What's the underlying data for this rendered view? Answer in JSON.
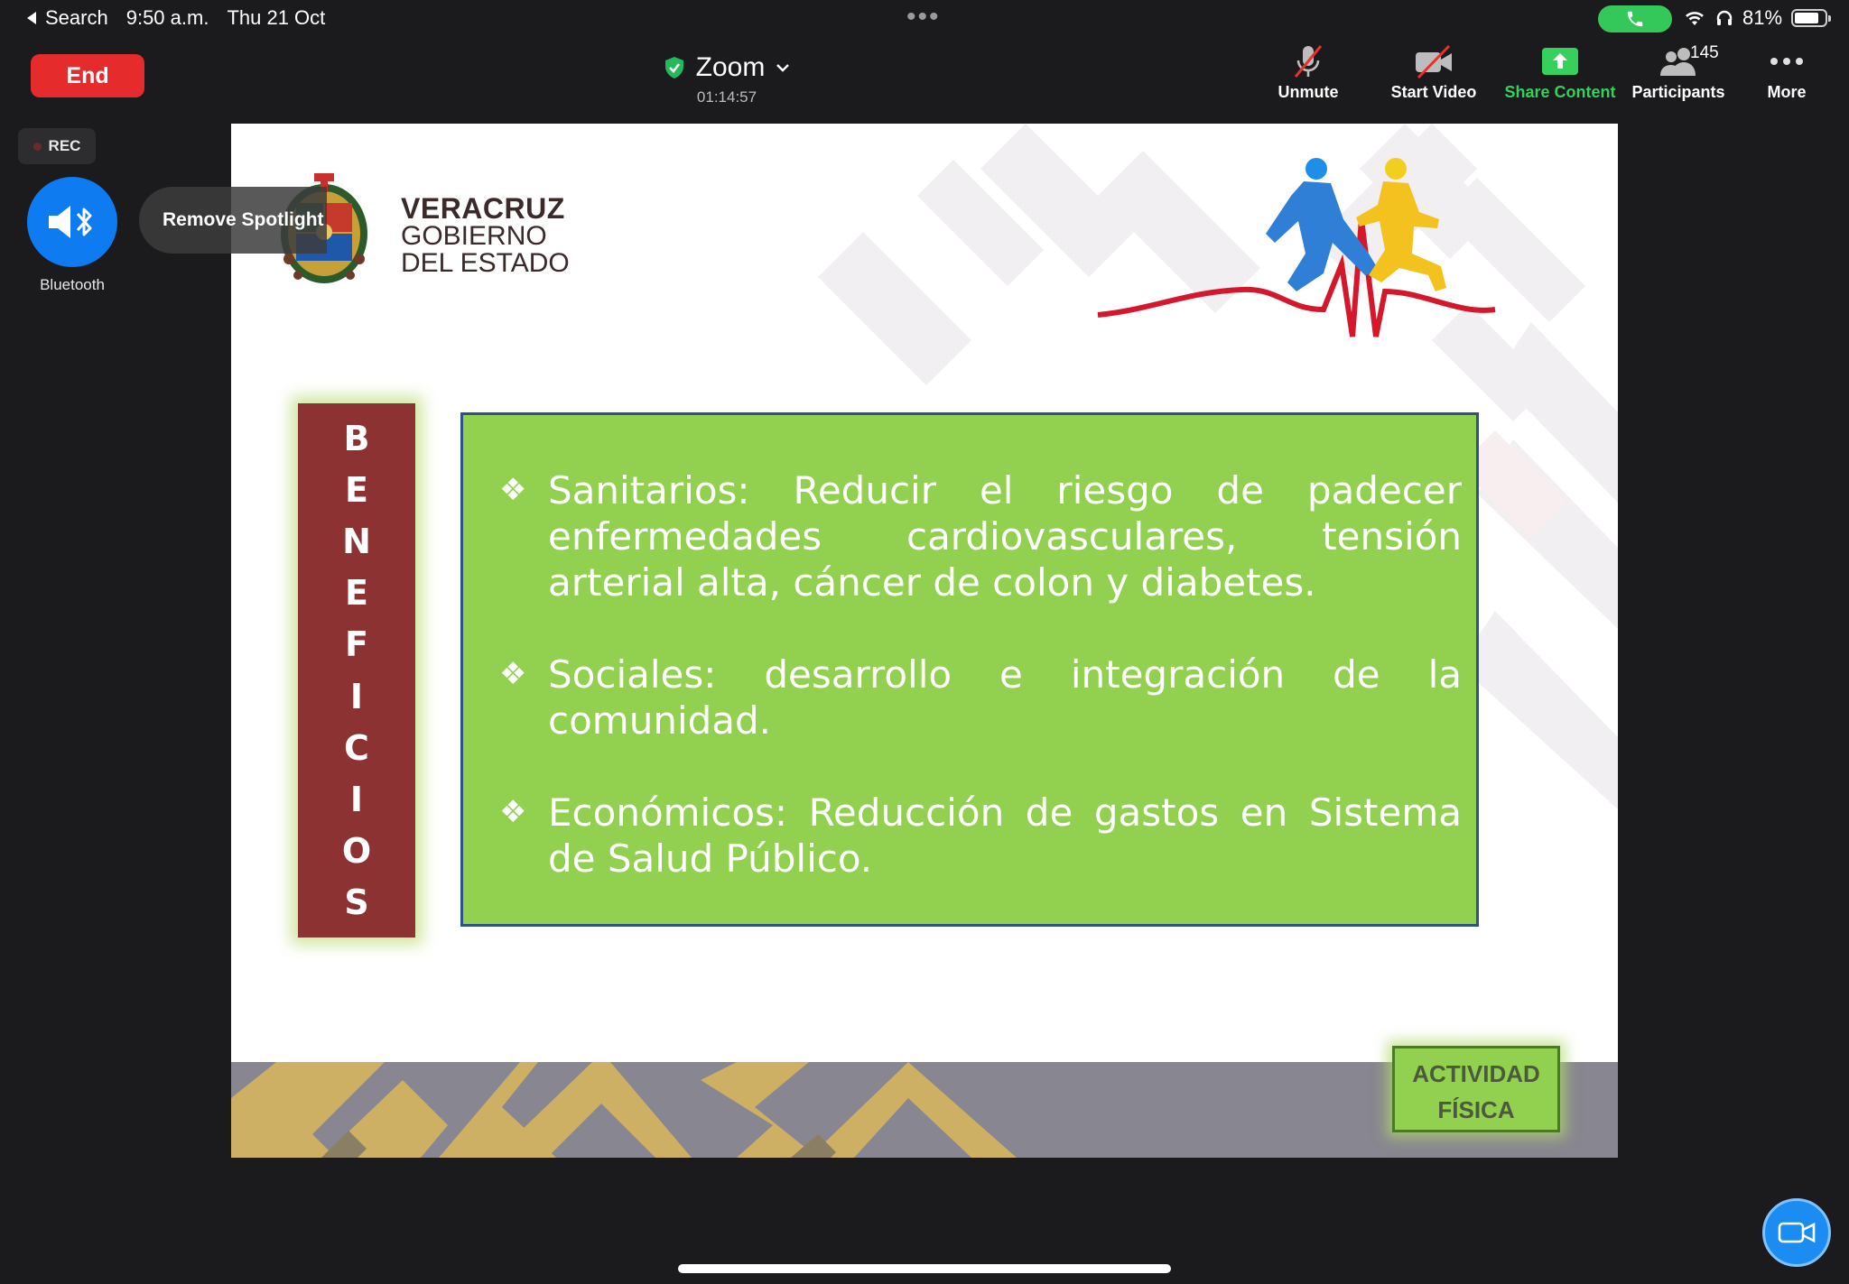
{
  "status_bar": {
    "back_label": "Search",
    "time": "9:50 a.m.",
    "date": "Thu 21 Oct",
    "battery": "81%",
    "battery_level": 0.81
  },
  "meeting": {
    "end_label": "End",
    "title": "Zoom",
    "timer": "01:14:57"
  },
  "toolbar": {
    "unmute": "Unmute",
    "start_video": "Start Video",
    "share_content": "Share Content",
    "participants": "Participants",
    "participants_count": "145",
    "more": "More"
  },
  "side": {
    "rec": "REC",
    "bluetooth": "Bluetooth",
    "remove_spotlight": "Remove Spotlight"
  },
  "slide": {
    "brand_line1": "VERACRUZ",
    "brand_line2": "GOBIERNO",
    "brand_line3": "DEL ESTADO",
    "vertical_letters": [
      "B",
      "E",
      "N",
      "E",
      "F",
      "I",
      "C",
      "I",
      "O",
      "S"
    ],
    "bullets": [
      "Sanitarios: Reducir el riesgo de padecer enfermedades cardiovasculares, tensión arterial alta, cáncer de colon y diabetes.",
      "Sociales: desarrollo e integración de la comunidad.",
      " Económicos: Reducción de gastos en Sistema de Salud Público."
    ],
    "badge_line1": "ACTIVIDAD",
    "badge_line2": "FÍSICA"
  },
  "colors": {
    "end_red": "#e52b2b",
    "share_green": "#35d15c",
    "bluetooth_blue": "#0f7bf0",
    "slide_green": "#92d050",
    "benefits_red": "#8d3232"
  }
}
